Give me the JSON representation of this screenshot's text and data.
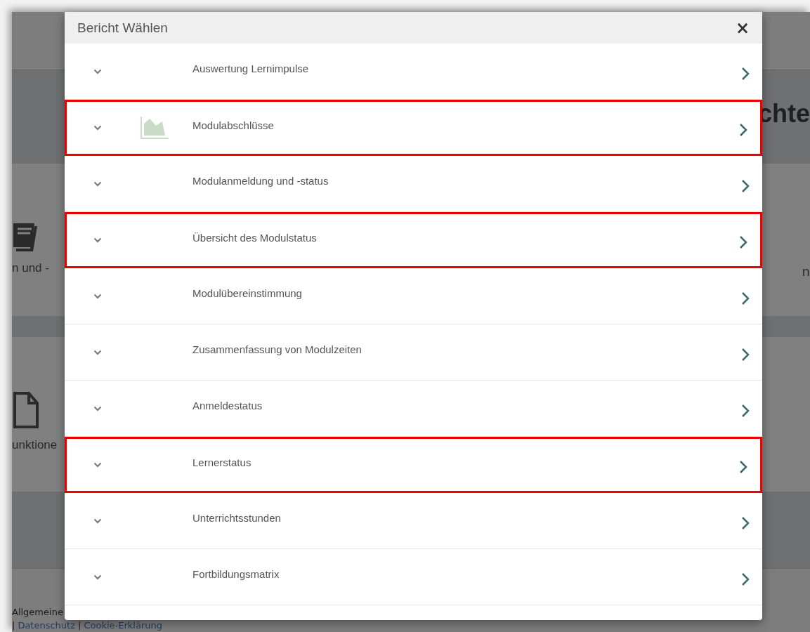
{
  "background": {
    "heading_fragment": "chte",
    "tile_1_label": "n und -",
    "tile_1_side_fragment": "n",
    "tile_2_label": "unktione",
    "footer_text": "Allgemeine",
    "footer_links": [
      "Datenschutz",
      "Cookie-Erklärung"
    ],
    "footer_separator": "|"
  },
  "dialog": {
    "title": "Bericht Wählen",
    "close": "×",
    "rows": [
      {
        "label": "Auswertung Lernimpulse",
        "kind": "plain",
        "highlighted": false
      },
      {
        "label": "Modulabschlüsse",
        "kind": "chart",
        "highlighted": true
      },
      {
        "label": "Modulanmeldung und -status",
        "kind": "plain",
        "highlighted": false
      },
      {
        "label": "Übersicht des Modulstatus",
        "kind": "plain",
        "highlighted": true
      },
      {
        "label": "Modulübereinstimmung",
        "kind": "plain",
        "highlighted": false
      },
      {
        "label": "Zusammenfassung von Modulzeiten",
        "kind": "plain",
        "highlighted": false
      },
      {
        "label": "Anmeldestatus",
        "kind": "plain",
        "highlighted": false
      },
      {
        "label": "Lernerstatus",
        "kind": "plain",
        "highlighted": true
      },
      {
        "label": "Unterrichtsstunden",
        "kind": "plain",
        "highlighted": false
      },
      {
        "label": "Fortbildungsmatrix",
        "kind": "plain",
        "highlighted": false
      }
    ]
  }
}
